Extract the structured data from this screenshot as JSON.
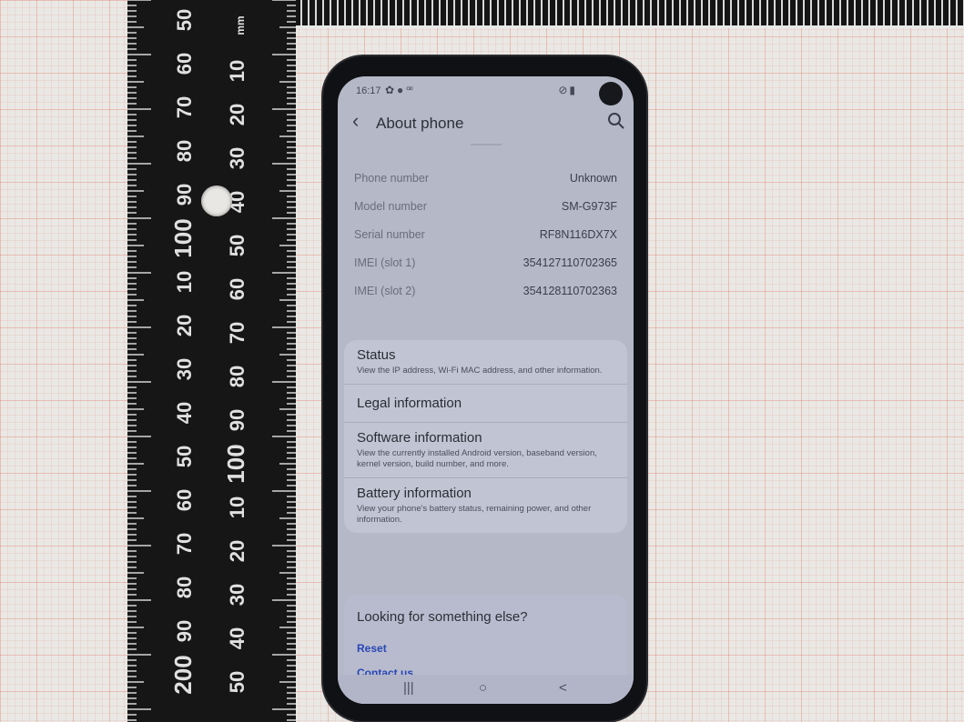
{
  "ruler": {
    "unit": "mm",
    "left_labels": [
      "50",
      "60",
      "70",
      "80",
      "90",
      "100",
      "10",
      "20",
      "30",
      "40",
      "50",
      "60",
      "70",
      "80",
      "90",
      "200"
    ],
    "right_labels": [
      "10",
      "20",
      "30",
      "40",
      "50",
      "60",
      "70",
      "80",
      "90",
      "100",
      "10",
      "20",
      "30",
      "40",
      "50"
    ]
  },
  "status_bar": {
    "time": "16:17"
  },
  "app_bar": {
    "title": "About phone"
  },
  "info": [
    {
      "label": "Phone number",
      "value": "Unknown"
    },
    {
      "label": "Model number",
      "value": "SM-G973F"
    },
    {
      "label": "Serial number",
      "value": "RF8N116DX7X"
    },
    {
      "label": "IMEI (slot 1)",
      "value": "354127110702365"
    },
    {
      "label": "IMEI (slot 2)",
      "value": "354128110702363"
    }
  ],
  "menu": [
    {
      "title": "Status",
      "desc": "View the IP address, Wi-Fi MAC address, and other information."
    },
    {
      "title": "Legal information",
      "desc": ""
    },
    {
      "title": "Software information",
      "desc": "View the currently installed Android version, baseband version, kernel version, build number, and more."
    },
    {
      "title": "Battery information",
      "desc": "View your phone's battery status, remaining power, and other information."
    }
  ],
  "looking": {
    "title": "Looking for something else?",
    "reset": "Reset",
    "contact": "Contact us"
  },
  "nav": {
    "recents": "|||",
    "home": "○",
    "back": "<"
  }
}
